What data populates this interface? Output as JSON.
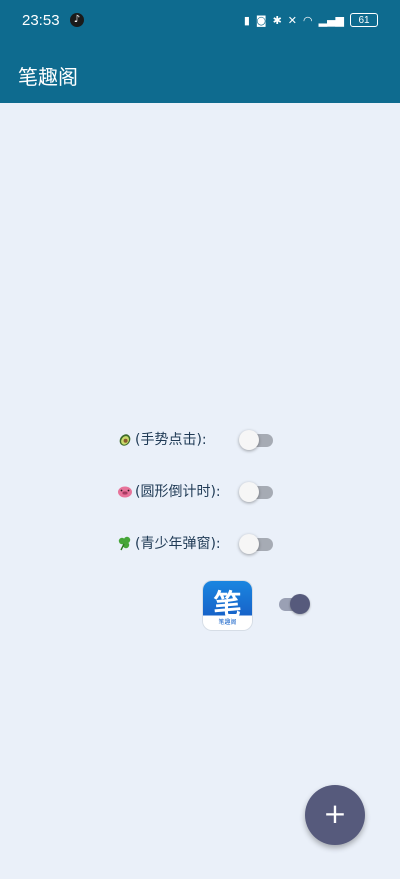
{
  "status_bar": {
    "time": "23:53",
    "battery": "61"
  },
  "app_bar": {
    "title": "笔趣阁"
  },
  "settings": [
    {
      "label": "(手势点击):",
      "icon": "avocado-emoji-icon",
      "enabled": false
    },
    {
      "label": "(圆形倒计时):",
      "icon": "pig-emoji-icon",
      "enabled": false
    },
    {
      "label": "(青少年弹窗):",
      "icon": "clover-emoji-icon",
      "enabled": false
    }
  ],
  "app_toggle": {
    "icon_glyph": "笔",
    "icon_caption": "笔趣阁",
    "enabled": true
  },
  "fab": {
    "label": "+"
  },
  "colors": {
    "app_bar": "#0e6b8f",
    "background": "#eaf0f9",
    "accent": "#565a7c"
  }
}
